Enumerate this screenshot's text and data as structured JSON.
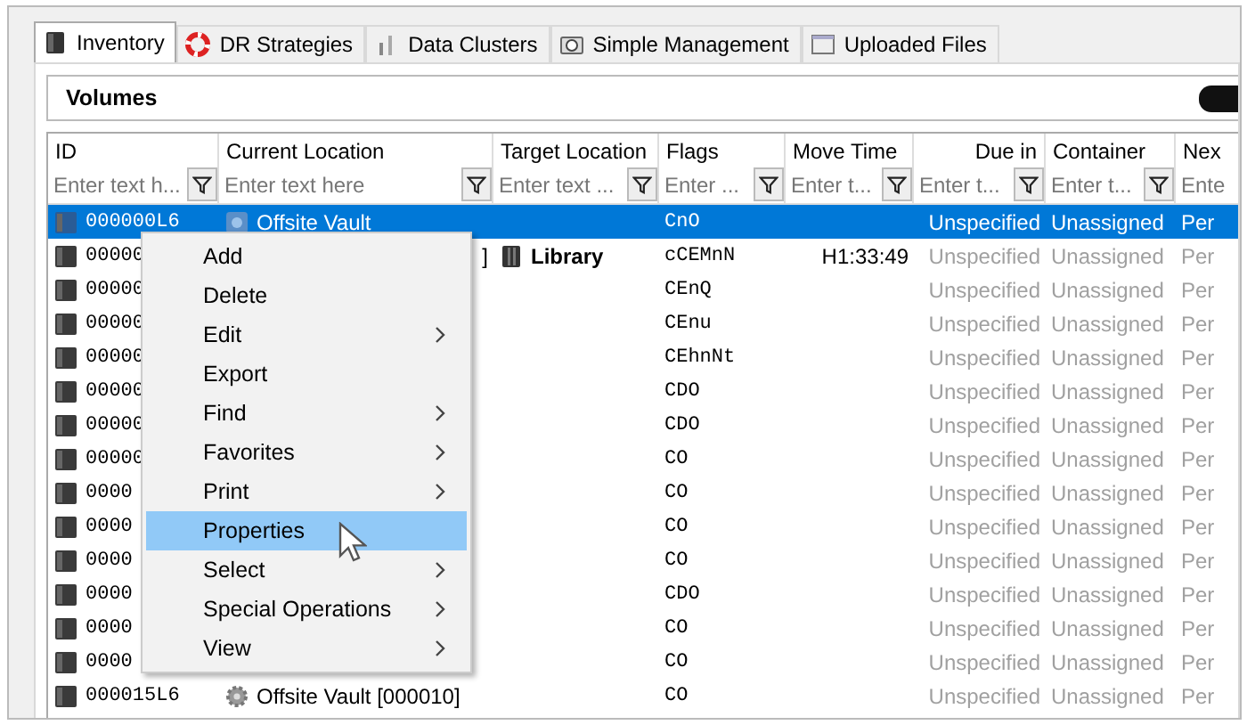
{
  "tabs": [
    {
      "label": "Inventory",
      "selected": true
    },
    {
      "label": "DR Strategies",
      "selected": false
    },
    {
      "label": "Data Clusters",
      "selected": false
    },
    {
      "label": "Simple Management",
      "selected": false
    },
    {
      "label": "Uploaded Files",
      "selected": false
    }
  ],
  "panel": {
    "title": "Volumes"
  },
  "table": {
    "columns": [
      {
        "label": "ID",
        "placeholder": "Enter text h..."
      },
      {
        "label": "Current Location",
        "placeholder": "Enter text here"
      },
      {
        "label": "Target Location",
        "placeholder": "Enter text ..."
      },
      {
        "label": "Flags",
        "placeholder": "Enter ..."
      },
      {
        "label": "Move Time",
        "placeholder": "Enter t..."
      },
      {
        "label": "Due in",
        "placeholder": "Enter t..."
      },
      {
        "label": "Container",
        "placeholder": "Enter t..."
      },
      {
        "label": "Nex",
        "placeholder": "Ente"
      }
    ],
    "rows": [
      {
        "kind": "vault",
        "id": "000000L6",
        "location": "Offsite Vault",
        "target": "",
        "flags": "CnO",
        "move_time": "",
        "due": "Unspecified",
        "container": "Unassigned",
        "next": "Per",
        "selected": true
      },
      {
        "kind": "library",
        "id": "00000",
        "location": "]",
        "target": "Library",
        "flags": "cCEMnN",
        "move_time": "H1:33:49",
        "due": "Unspecified",
        "container": "Unassigned",
        "next": "Per",
        "selected": false
      },
      {
        "kind": "covered",
        "id": "00000",
        "location": "",
        "target": "",
        "flags": "CEnQ",
        "move_time": "",
        "due": "Unspecified",
        "container": "Unassigned",
        "next": "Per",
        "selected": false
      },
      {
        "kind": "covered",
        "id": "00000",
        "location": "",
        "target": "",
        "flags": "CEnu",
        "move_time": "",
        "due": "Unspecified",
        "container": "Unassigned",
        "next": "Per",
        "selected": false
      },
      {
        "kind": "covered",
        "id": "00000",
        "location": "",
        "target": "",
        "flags": "CEhnNt",
        "move_time": "",
        "due": "Unspecified",
        "container": "Unassigned",
        "next": "Per",
        "selected": false
      },
      {
        "kind": "covered",
        "id": "00000",
        "location": "",
        "target": "",
        "flags": "CDO",
        "move_time": "",
        "due": "Unspecified",
        "container": "Unassigned",
        "next": "Per",
        "selected": false
      },
      {
        "kind": "covered",
        "id": "00000",
        "location": "",
        "target": "",
        "flags": "CDO",
        "move_time": "",
        "due": "Unspecified",
        "container": "Unassigned",
        "next": "Per",
        "selected": false
      },
      {
        "kind": "covered",
        "id": "00000",
        "location": "",
        "target": "",
        "flags": "CO",
        "move_time": "",
        "due": "Unspecified",
        "container": "Unassigned",
        "next": "Per",
        "selected": false
      },
      {
        "kind": "covered",
        "id": "0000",
        "location": "",
        "target": "",
        "flags": "CO",
        "move_time": "",
        "due": "Unspecified",
        "container": "Unassigned",
        "next": "Per",
        "selected": false
      },
      {
        "kind": "covered",
        "id": "0000",
        "location": "",
        "target": "",
        "flags": "CO",
        "move_time": "",
        "due": "Unspecified",
        "container": "Unassigned",
        "next": "Per",
        "selected": false
      },
      {
        "kind": "covered",
        "id": "0000",
        "location": "",
        "target": "",
        "flags": "CO",
        "move_time": "",
        "due": "Unspecified",
        "container": "Unassigned",
        "next": "Per",
        "selected": false
      },
      {
        "kind": "covered",
        "id": "0000",
        "location": "",
        "target": "",
        "flags": "CDO",
        "move_time": "",
        "due": "Unspecified",
        "container": "Unassigned",
        "next": "Per",
        "selected": false
      },
      {
        "kind": "covered",
        "id": "0000",
        "location": "",
        "target": "",
        "flags": "CO",
        "move_time": "",
        "due": "Unspecified",
        "container": "Unassigned",
        "next": "Per",
        "selected": false
      },
      {
        "kind": "covered",
        "id": "0000",
        "location": "",
        "target": "",
        "flags": "CO",
        "move_time": "",
        "due": "Unspecified",
        "container": "Unassigned",
        "next": "Per",
        "selected": false
      },
      {
        "kind": "gear",
        "id": "000015L6",
        "location": "Offsite Vault [000010]",
        "target": "",
        "flags": "CO",
        "move_time": "",
        "due": "Unspecified",
        "container": "Unassigned",
        "next": "Per",
        "selected": false
      }
    ]
  },
  "context_menu": {
    "items": [
      {
        "label": "Add",
        "submenu": false,
        "selected": false
      },
      {
        "label": "Delete",
        "submenu": false,
        "selected": false
      },
      {
        "label": "Edit",
        "submenu": true,
        "selected": false
      },
      {
        "label": "Export",
        "submenu": false,
        "selected": false
      },
      {
        "label": "Find",
        "submenu": true,
        "selected": false
      },
      {
        "label": "Favorites",
        "submenu": true,
        "selected": false
      },
      {
        "label": "Print",
        "submenu": true,
        "selected": false
      },
      {
        "label": "Properties",
        "submenu": false,
        "selected": true
      },
      {
        "label": "Select",
        "submenu": true,
        "selected": false
      },
      {
        "label": "Special Operations",
        "submenu": true,
        "selected": false
      },
      {
        "label": "View",
        "submenu": true,
        "selected": false
      }
    ]
  }
}
